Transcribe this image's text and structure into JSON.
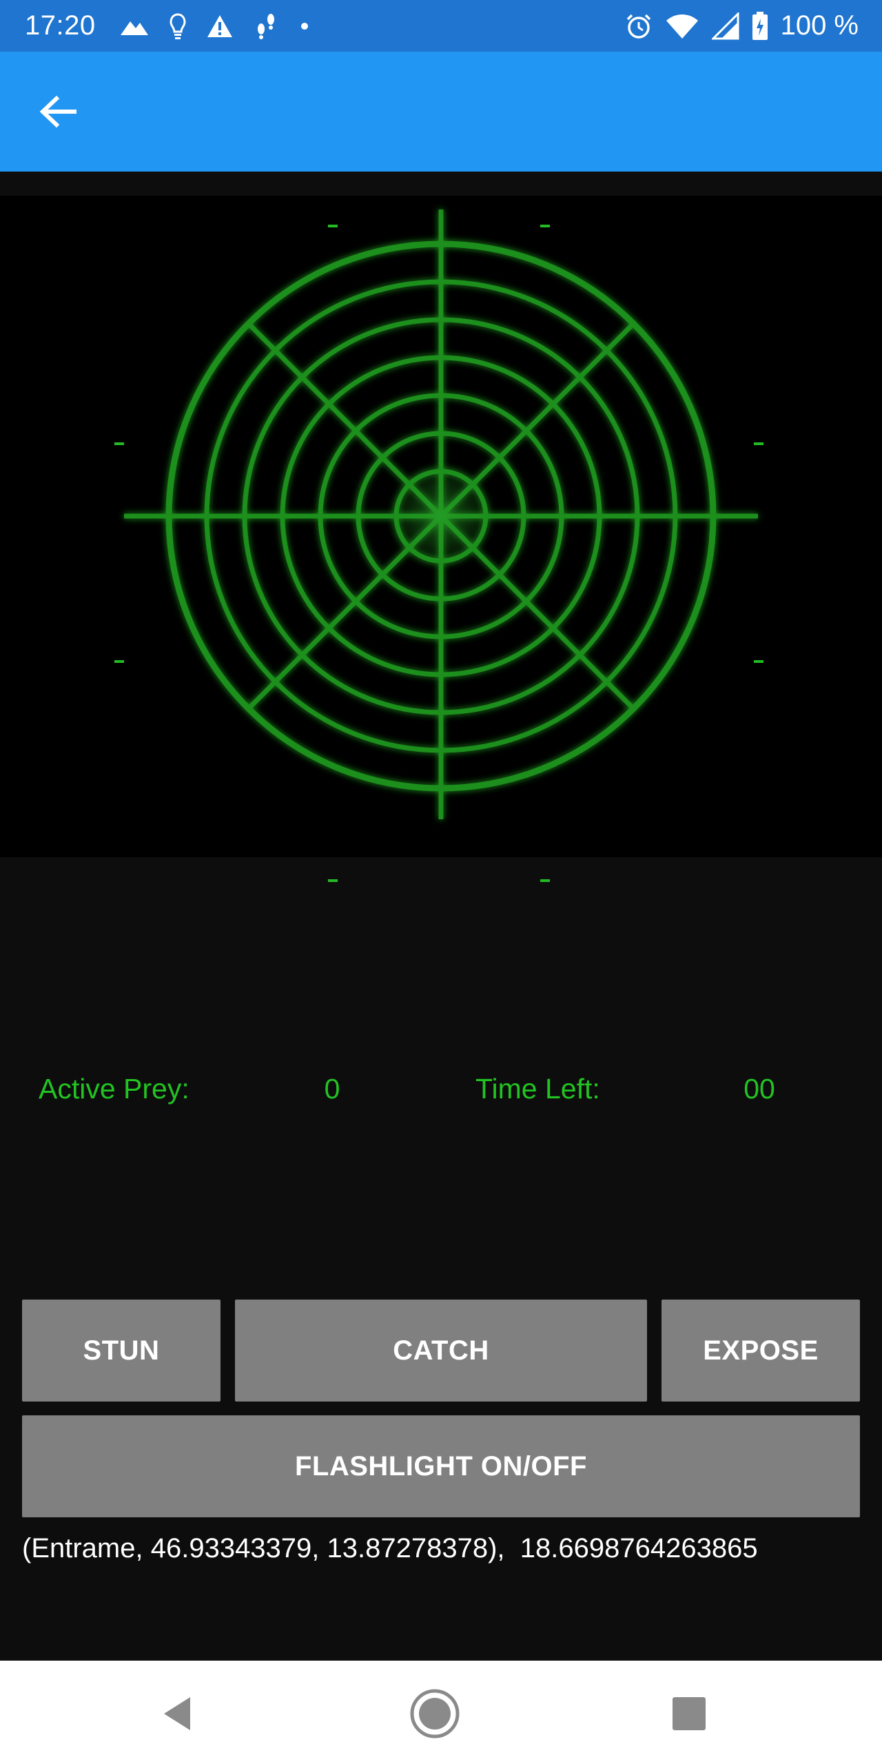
{
  "status_bar": {
    "time": "17:20",
    "battery_text": "100 %",
    "left_icons": [
      "mountain-icon",
      "lightbulb-icon",
      "warning-icon",
      "footsteps-icon",
      "dot-icon"
    ],
    "right_icons": [
      "alarm-icon",
      "wifi-icon",
      "signal-icon",
      "battery-icon"
    ]
  },
  "app_bar": {
    "back_icon": "arrow-left-icon",
    "color": "#2196f3"
  },
  "radar": {
    "color": "#1f8f1f",
    "rings": 7
  },
  "stats": {
    "active_prey_label": "Active Prey:",
    "active_prey_value": "0",
    "time_left_label": "Time Left:",
    "time_left_value": "00",
    "color": "#22c322"
  },
  "buttons": {
    "stun": "STUN",
    "catch": "CATCH",
    "expose": "EXPOSE",
    "flashlight": "FLASHLIGHT ON/OFF"
  },
  "coords_text": "(Entrame, 46.93343379, 13.87278378),  18.6698764263865",
  "nav_bar": {
    "back_icon": "nav-back-icon",
    "home_icon": "nav-home-icon",
    "recents_icon": "nav-recents-icon"
  }
}
